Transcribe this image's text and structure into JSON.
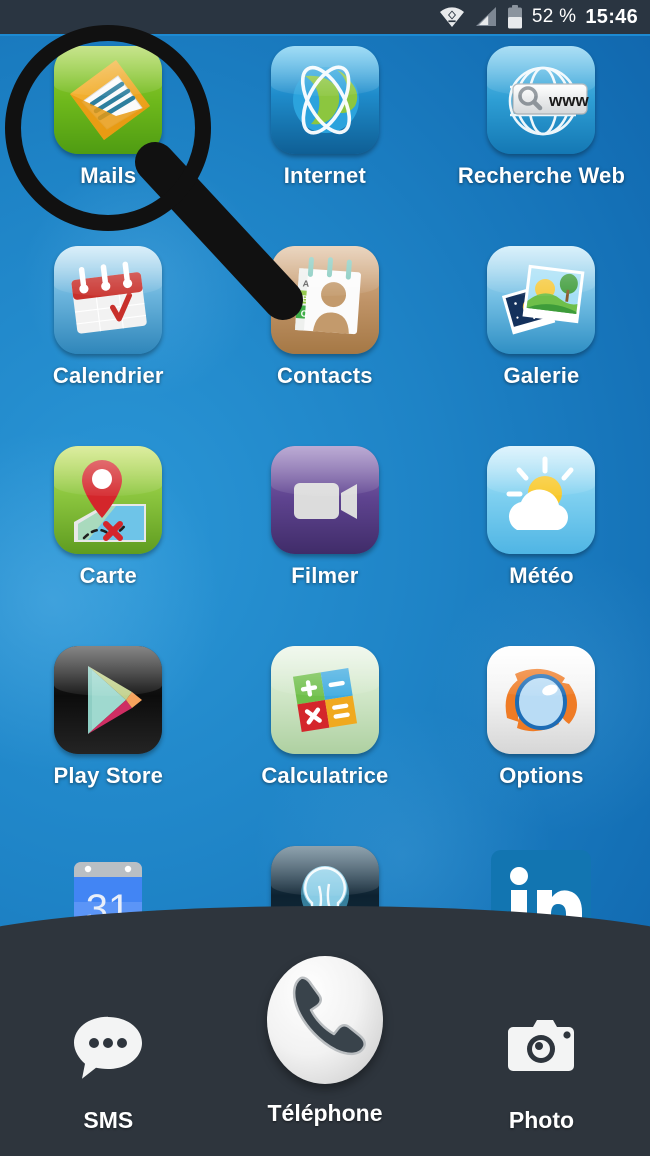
{
  "status_bar": {
    "battery_percent": "52 %",
    "time": "15:46",
    "icons": [
      "wifi-icon",
      "signal-icon",
      "battery-icon"
    ]
  },
  "home_screen": {
    "rows": [
      [
        {
          "label": "Mails",
          "icon": "mails-icon",
          "highlighted": true
        },
        {
          "label": "Internet",
          "icon": "internet-icon",
          "highlighted": false
        },
        {
          "label": "Recherche Web",
          "icon": "web-search-icon",
          "highlighted": false
        }
      ],
      [
        {
          "label": "Calendrier",
          "icon": "calendar-icon",
          "highlighted": false
        },
        {
          "label": "Contacts",
          "icon": "contacts-icon",
          "highlighted": false
        },
        {
          "label": "Galerie",
          "icon": "gallery-icon",
          "highlighted": false
        }
      ],
      [
        {
          "label": "Carte",
          "icon": "map-icon",
          "highlighted": false
        },
        {
          "label": "Filmer",
          "icon": "camcorder-icon",
          "highlighted": false
        },
        {
          "label": "Météo",
          "icon": "weather-icon",
          "highlighted": false
        }
      ],
      [
        {
          "label": "Play Store",
          "icon": "play-store-icon",
          "highlighted": false
        },
        {
          "label": "Calculatrice",
          "icon": "calculator-icon",
          "highlighted": false
        },
        {
          "label": "Options",
          "icon": "options-icon",
          "highlighted": false
        }
      ],
      [
        {
          "label": "",
          "icon": "google-calendar-icon",
          "highlighted": false
        },
        {
          "label": "",
          "icon": "flashlight-icon",
          "highlighted": false
        },
        {
          "label": "",
          "icon": "linkedin-icon",
          "highlighted": false
        }
      ]
    ],
    "partial_row_note": "31"
  },
  "dock": {
    "items": [
      {
        "label": "SMS",
        "icon": "sms-icon"
      },
      {
        "label": "Téléphone",
        "icon": "phone-icon"
      },
      {
        "label": "Photo",
        "icon": "camera-icon"
      }
    ]
  },
  "annotation": {
    "type": "magnifier-highlight",
    "target": "Mails",
    "color": "#111111"
  },
  "colors": {
    "wallpaper_blue": "#1a7fc1",
    "status_bar": "#2a3541",
    "dock": "#2e353d",
    "label_text": "#ffffff"
  }
}
